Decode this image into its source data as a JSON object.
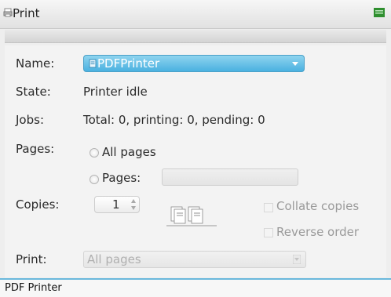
{
  "window": {
    "title": "Print",
    "status_text": "PDF Printer"
  },
  "form": {
    "name_label": "Name:",
    "printer": "PDFPrinter",
    "state_label": "State:",
    "state_value": "Printer idle",
    "jobs_label": "Jobs:",
    "jobs_value": "Total: 0, printing: 0, pending: 0",
    "pages_label": "Pages:",
    "all_pages_option": "All pages",
    "pages_option": "Pages:",
    "pages_range_value": "",
    "copies_label": "Copies:",
    "copies_value": "1",
    "collate_label": "Collate copies",
    "reverse_label": "Reverse order",
    "print_label": "Print:",
    "print_selected": "All pages"
  },
  "colors": {
    "accent": "#4ab1e0",
    "title_icon": "#3a9a3a"
  },
  "icons": {
    "title": "printer-icon",
    "title_right": "window-menu-icon",
    "combo_printer": "printer-icon",
    "combo_arrow": "chevron-down-icon"
  }
}
